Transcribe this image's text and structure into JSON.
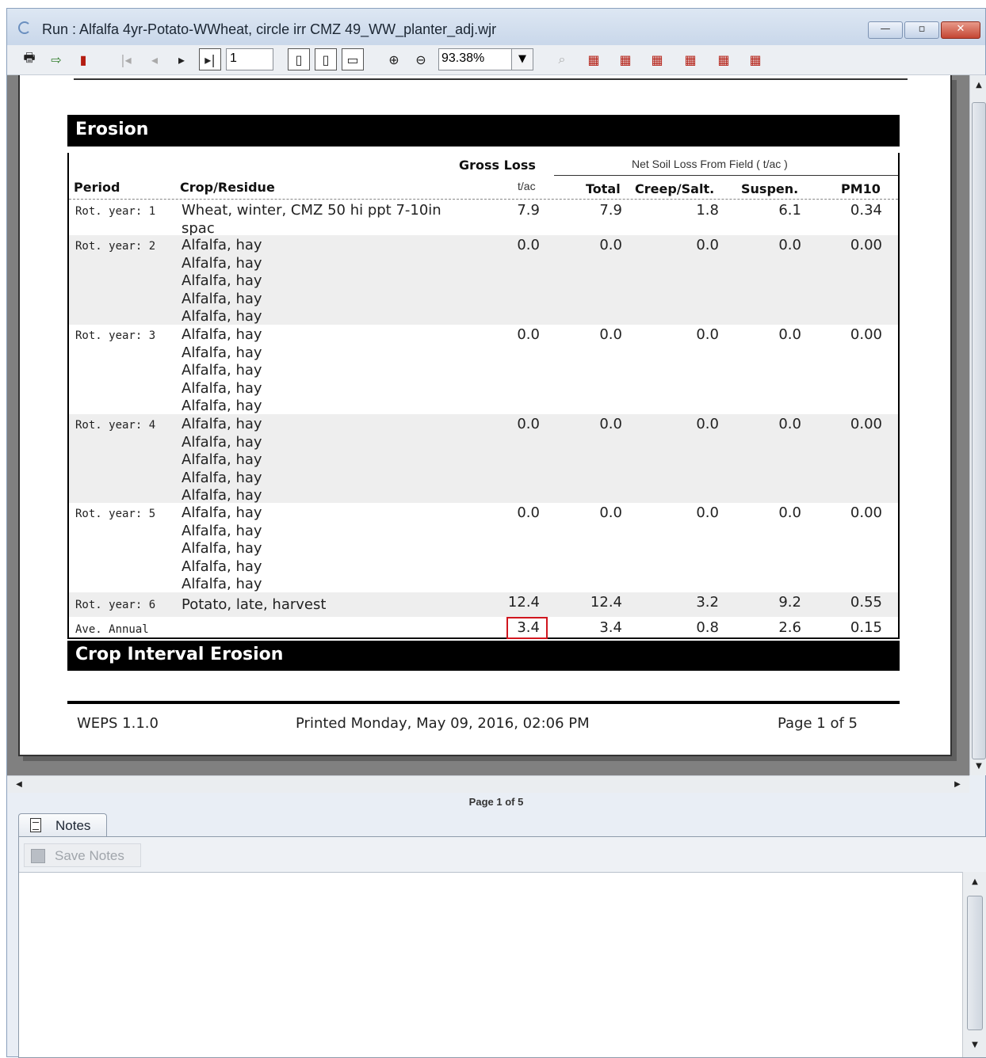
{
  "window": {
    "title": "Run : Alfalfa 4yr-Potato-WWheat, circle irr CMZ 49_WW_planter_adj.wjr",
    "minimize": "—",
    "maximize": "▫",
    "close": "✕"
  },
  "toolbar": {
    "page_number": "1",
    "zoom": "93.38%"
  },
  "report": {
    "erosion_title": "Erosion",
    "headers": {
      "gross_loss": "Gross Loss",
      "net_soil_loss": "Net Soil Loss From Field ( t/ac )",
      "period": "Period",
      "crop_residue": "Crop/Residue",
      "unit": "t/ac",
      "total": "Total",
      "creep_salt": "Creep/Salt.",
      "suspen": "Suspen.",
      "pm10": "PM10"
    },
    "rows": [
      {
        "period": "Rot. year: 1",
        "crops": [
          "Wheat, winter, CMZ 50 hi ppt 7-10in",
          "spac"
        ],
        "gross": "7.9",
        "total": "7.9",
        "creep": "1.8",
        "suspen": "6.1",
        "pm10": "0.34"
      },
      {
        "period": "Rot. year: 2",
        "crops": [
          "Alfalfa, hay",
          "Alfalfa, hay",
          "Alfalfa, hay",
          "Alfalfa, hay",
          "Alfalfa, hay"
        ],
        "gross": "0.0",
        "total": "0.0",
        "creep": "0.0",
        "suspen": "0.0",
        "pm10": "0.00"
      },
      {
        "period": "Rot. year: 3",
        "crops": [
          "Alfalfa, hay",
          "Alfalfa, hay",
          "Alfalfa, hay",
          "Alfalfa, hay",
          "Alfalfa, hay"
        ],
        "gross": "0.0",
        "total": "0.0",
        "creep": "0.0",
        "suspen": "0.0",
        "pm10": "0.00"
      },
      {
        "period": "Rot. year: 4",
        "crops": [
          "Alfalfa, hay",
          "Alfalfa, hay",
          "Alfalfa, hay",
          "Alfalfa, hay",
          "Alfalfa, hay"
        ],
        "gross": "0.0",
        "total": "0.0",
        "creep": "0.0",
        "suspen": "0.0",
        "pm10": "0.00"
      },
      {
        "period": "Rot. year: 5",
        "crops": [
          "Alfalfa, hay",
          "Alfalfa, hay",
          "Alfalfa, hay",
          "Alfalfa, hay",
          "Alfalfa, hay"
        ],
        "gross": "0.0",
        "total": "0.0",
        "creep": "0.0",
        "suspen": "0.0",
        "pm10": "0.00"
      },
      {
        "period": "Rot. year: 6",
        "crops": [
          "Potato, late, harvest"
        ],
        "gross": "12.4",
        "total": "12.4",
        "creep": "3.2",
        "suspen": "9.2",
        "pm10": "0.55"
      },
      {
        "period": "Ave. Annual",
        "crops": [],
        "gross": "3.4",
        "total": "3.4",
        "creep": "0.8",
        "suspen": "2.6",
        "pm10": "0.15"
      }
    ],
    "crop_interval_title": "Crop Interval Erosion",
    "footer": {
      "version": "WEPS 1.1.0",
      "printed": "Printed  Monday, May 09, 2016, 02:06 PM",
      "page": "Page 1 of 5"
    }
  },
  "status": {
    "page_indicator": "Page 1 of 5"
  },
  "notes": {
    "tab_label": "Notes",
    "save_label": "Save Notes",
    "content": ""
  },
  "colors": {
    "highlight": "#d0161e",
    "section_bar": "#000000"
  }
}
